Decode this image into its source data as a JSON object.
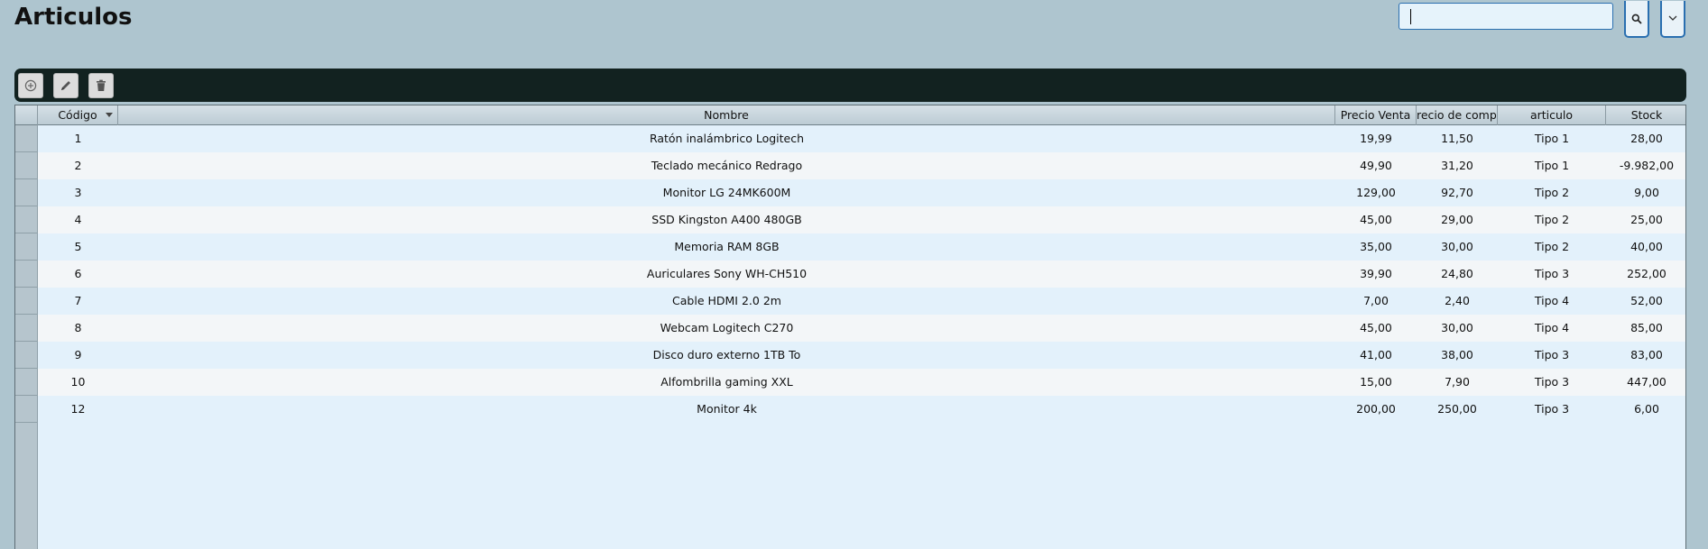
{
  "page": {
    "title": "Articulos"
  },
  "search": {
    "value": "",
    "placeholder": ""
  },
  "icons": {
    "search": "search-icon",
    "dropdown": "chevron-down-icon",
    "add": "add-circle-icon",
    "edit": "pencil-icon",
    "delete": "trash-icon"
  },
  "colors": {
    "background": "#aec5cf",
    "toolbar": "#122220",
    "accent": "#2a6fb0",
    "row_odd": "#e3f1fb",
    "row_even": "#f3f6f8"
  },
  "table": {
    "columns": [
      "Código",
      "Nombre",
      "Precio Venta",
      "recio de compr",
      "articulo",
      "Stock"
    ],
    "sort_column": "Código",
    "rows": [
      {
        "codigo": "1",
        "nombre": "Ratón inalámbrico Logitech",
        "precio_venta": "19,99",
        "precio_compra": "11,50",
        "articulo": "Tipo 1",
        "stock": "28,00"
      },
      {
        "codigo": "2",
        "nombre": "Teclado mecánico Redrago",
        "precio_venta": "49,90",
        "precio_compra": "31,20",
        "articulo": "Tipo 1",
        "stock": "-9.982,00"
      },
      {
        "codigo": "3",
        "nombre": "Monitor LG 24MK600M",
        "precio_venta": "129,00",
        "precio_compra": "92,70",
        "articulo": "Tipo 2",
        "stock": "9,00"
      },
      {
        "codigo": "4",
        "nombre": "SSD Kingston A400 480GB",
        "precio_venta": "45,00",
        "precio_compra": "29,00",
        "articulo": "Tipo 2",
        "stock": "25,00"
      },
      {
        "codigo": "5",
        "nombre": "Memoria RAM 8GB",
        "precio_venta": "35,00",
        "precio_compra": "30,00",
        "articulo": "Tipo 2",
        "stock": "40,00"
      },
      {
        "codigo": "6",
        "nombre": "Auriculares Sony WH-CH510",
        "precio_venta": "39,90",
        "precio_compra": "24,80",
        "articulo": "Tipo 3",
        "stock": "252,00"
      },
      {
        "codigo": "7",
        "nombre": "Cable HDMI 2.0 2m",
        "precio_venta": "7,00",
        "precio_compra": "2,40",
        "articulo": "Tipo 4",
        "stock": "52,00"
      },
      {
        "codigo": "8",
        "nombre": "Webcam Logitech C270",
        "precio_venta": "45,00",
        "precio_compra": "30,00",
        "articulo": "Tipo 4",
        "stock": "85,00"
      },
      {
        "codigo": "9",
        "nombre": "Disco duro externo 1TB To",
        "precio_venta": "41,00",
        "precio_compra": "38,00",
        "articulo": "Tipo 3",
        "stock": "83,00"
      },
      {
        "codigo": "10",
        "nombre": "Alfombrilla gaming XXL",
        "precio_venta": "15,00",
        "precio_compra": "7,90",
        "articulo": "Tipo 3",
        "stock": "447,00"
      },
      {
        "codigo": "12",
        "nombre": "Monitor 4k",
        "precio_venta": "200,00",
        "precio_compra": "250,00",
        "articulo": "Tipo 3",
        "stock": "6,00"
      }
    ]
  }
}
